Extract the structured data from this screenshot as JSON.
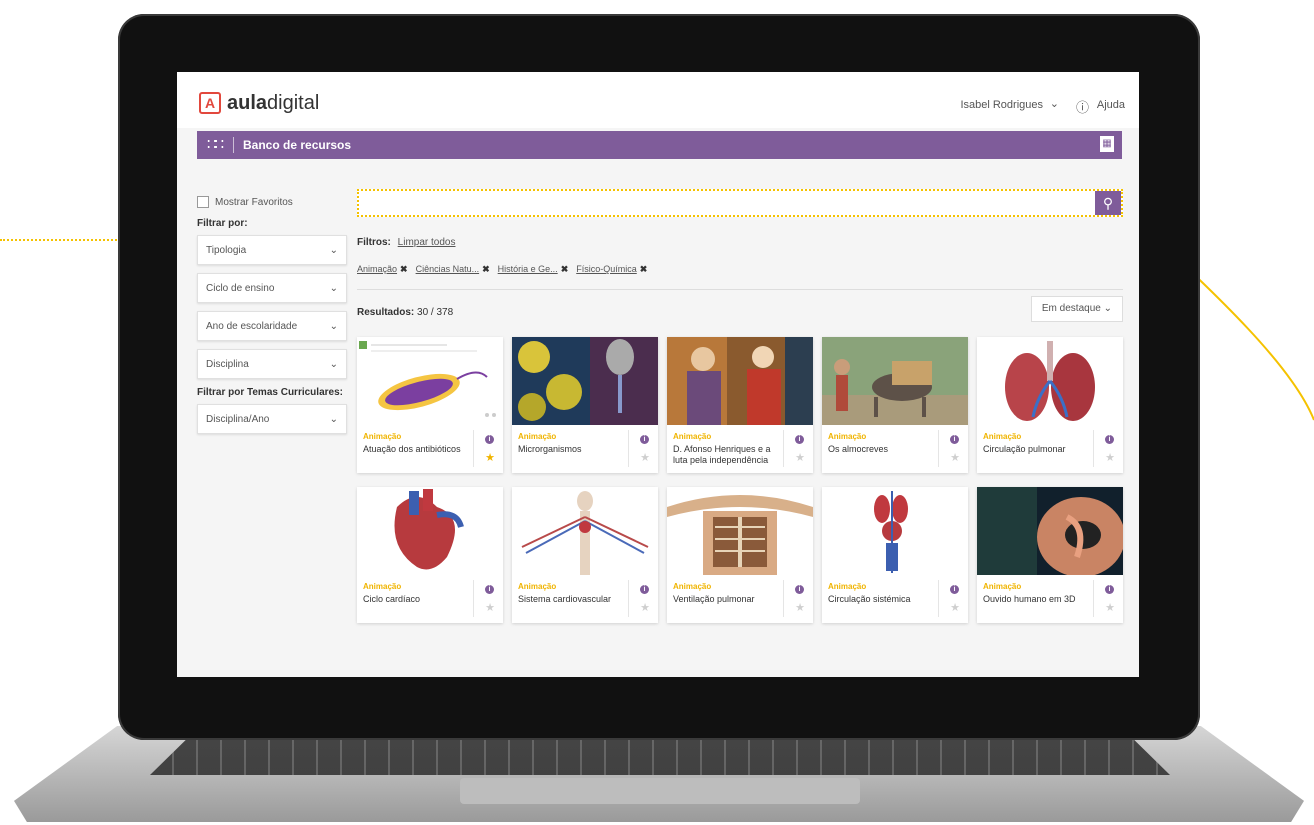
{
  "app": {
    "logo_letter": "A",
    "logo_bold": "aula",
    "logo_light": "digital",
    "user_name": "Isabel Rodrigues",
    "help_label": "Ajuda"
  },
  "nav": {
    "title": "Banco de recursos"
  },
  "sidebar": {
    "favorites_label": "Mostrar Favoritos",
    "filter_by_label": "Filtrar por:",
    "filters": [
      "Tipologia",
      "Ciclo de ensino",
      "Ano de escolaridade",
      "Disciplina"
    ],
    "curricular_label": "Filtrar por Temas Curriculares:",
    "curricular_select": "Disciplina/Ano"
  },
  "search": {
    "value": "",
    "placeholder": ""
  },
  "filters_bar": {
    "label": "Filtros:",
    "clear_all": "Limpar todos",
    "chips": [
      "Animação",
      "Ciências Natu...",
      "História e Ge...",
      "Físico-Química"
    ]
  },
  "results": {
    "label": "Resultados:",
    "count": "30 / 378",
    "sort": "Em destaque"
  },
  "cards": [
    {
      "type": "Animação",
      "title": "Atuação dos antibióticos",
      "favorite": true
    },
    {
      "type": "Animação",
      "title": "Microrganismos",
      "favorite": false
    },
    {
      "type": "Animação",
      "title": "D. Afonso Henriques e a luta pela independência",
      "favorite": false
    },
    {
      "type": "Animação",
      "title": "Os almocreves",
      "favorite": false
    },
    {
      "type": "Animação",
      "title": "Circulação pulmonar",
      "favorite": false
    },
    {
      "type": "Animação",
      "title": "Ciclo cardíaco",
      "favorite": false
    },
    {
      "type": "Animação",
      "title": "Sistema cardiovascular",
      "favorite": false
    },
    {
      "type": "Animação",
      "title": "Ventilação pulmonar",
      "favorite": false
    },
    {
      "type": "Animação",
      "title": "Circulação sistémica",
      "favorite": false
    },
    {
      "type": "Animação",
      "title": "Ouvido humano em 3D",
      "favorite": false
    }
  ],
  "colors": {
    "brand_purple": "#7f5c9a",
    "accent_yellow": "#f0b400",
    "callout_yellow": "#f5c200",
    "logo_red": "#e2483d"
  }
}
